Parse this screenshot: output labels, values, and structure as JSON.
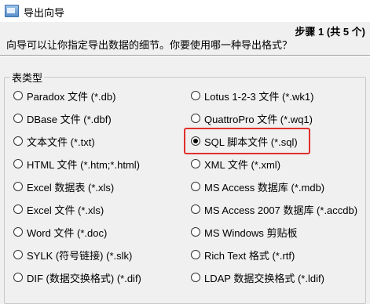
{
  "window": {
    "title": "导出向导",
    "step": "步骤 1 (共 5 个)"
  },
  "description": "向导可以让你指定导出数据的细节。你要使用哪一种导出格式？",
  "group_label": "表类型",
  "options_left": [
    {
      "label": "Paradox 文件 (*.db)",
      "checked": false
    },
    {
      "label": "DBase 文件 (*.dbf)",
      "checked": false
    },
    {
      "label": "文本文件 (*.txt)",
      "checked": false
    },
    {
      "label": "HTML 文件 (*.htm;*.html)",
      "checked": false
    },
    {
      "label": "Excel 数据表 (*.xls)",
      "checked": false
    },
    {
      "label": "Excel 文件 (*.xls)",
      "checked": false
    },
    {
      "label": "Word 文件 (*.doc)",
      "checked": false
    },
    {
      "label": "SYLK (符号链接) (*.slk)",
      "checked": false
    },
    {
      "label": "DIF (数据交换格式) (*.dif)",
      "checked": false
    }
  ],
  "options_right": [
    {
      "label": "Lotus 1-2-3 文件 (*.wk1)",
      "checked": false
    },
    {
      "label": "QuattroPro 文件 (*.wq1)",
      "checked": false
    },
    {
      "label": "SQL 脚本文件 (*.sql)",
      "checked": true
    },
    {
      "label": "XML 文件 (*.xml)",
      "checked": false
    },
    {
      "label": "MS Access 数据库 (*.mdb)",
      "checked": false
    },
    {
      "label": "MS Access 2007 数据库 (*.accdb)",
      "checked": false
    },
    {
      "label": "MS Windows 剪贴板",
      "checked": false
    },
    {
      "label": "Rich Text 格式 (*.rtf)",
      "checked": false
    },
    {
      "label": "LDAP 数据交换格式 (*.ldif)",
      "checked": false
    }
  ],
  "colors": {
    "highlight": "#e0302d",
    "background": "#f0f0f0"
  }
}
